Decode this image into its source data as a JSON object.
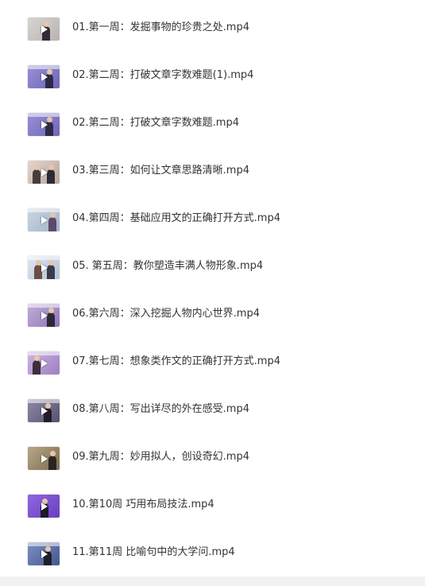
{
  "files": [
    {
      "name": "01.第一周：发掘事物的珍贵之处.mp4",
      "thumb_icon": "video-thumbnail",
      "thumb_color": "#cfcac6"
    },
    {
      "name": "02.第二周：打破文章字数难题(1).mp4",
      "thumb_icon": "video-thumbnail",
      "thumb_color": "#8b83c9"
    },
    {
      "name": "02.第二周：打破文章字数难题.mp4",
      "thumb_icon": "video-thumbnail",
      "thumb_color": "#8b83c9"
    },
    {
      "name": "03.第三周：如何让文章思路清晰.mp4",
      "thumb_icon": "video-thumbnail",
      "thumb_color": "#c9b8ae"
    },
    {
      "name": "04.第四周：基础应用文的正确打开方式.mp4",
      "thumb_icon": "video-thumbnail",
      "thumb_color": "#b7c6d6"
    },
    {
      "name": "05. 第五周：教你塑造丰满人物形象.mp4",
      "thumb_icon": "video-thumbnail",
      "thumb_color": "#c8d2e2"
    },
    {
      "name": "06.第六周：深入挖掘人物内心世界.mp4",
      "thumb_icon": "video-thumbnail",
      "thumb_color": "#a78fc7"
    },
    {
      "name": "07.第七周：想象类作文的正确打开方式.mp4",
      "thumb_icon": "video-thumbnail",
      "thumb_color": "#b59ad0"
    },
    {
      "name": "08.第八周：写出详尽的外在感受.mp4",
      "thumb_icon": "video-thumbnail",
      "thumb_color": "#6e6a88"
    },
    {
      "name": "09.第九周：妙用拟人，创设奇幻.mp4",
      "thumb_icon": "video-thumbnail",
      "thumb_color": "#9c8a6c"
    },
    {
      "name": "10.第10周 巧用布局技法.mp4",
      "thumb_icon": "video-thumbnail",
      "thumb_color": "#7a4fd0"
    },
    {
      "name": "11.第11周 比喻句中的大学问.mp4",
      "thumb_icon": "video-thumbnail",
      "thumb_color": "#5b6fa8"
    }
  ],
  "colors": {
    "text": "#333333",
    "background": "#ffffff",
    "footer": "#f1f1f3"
  }
}
